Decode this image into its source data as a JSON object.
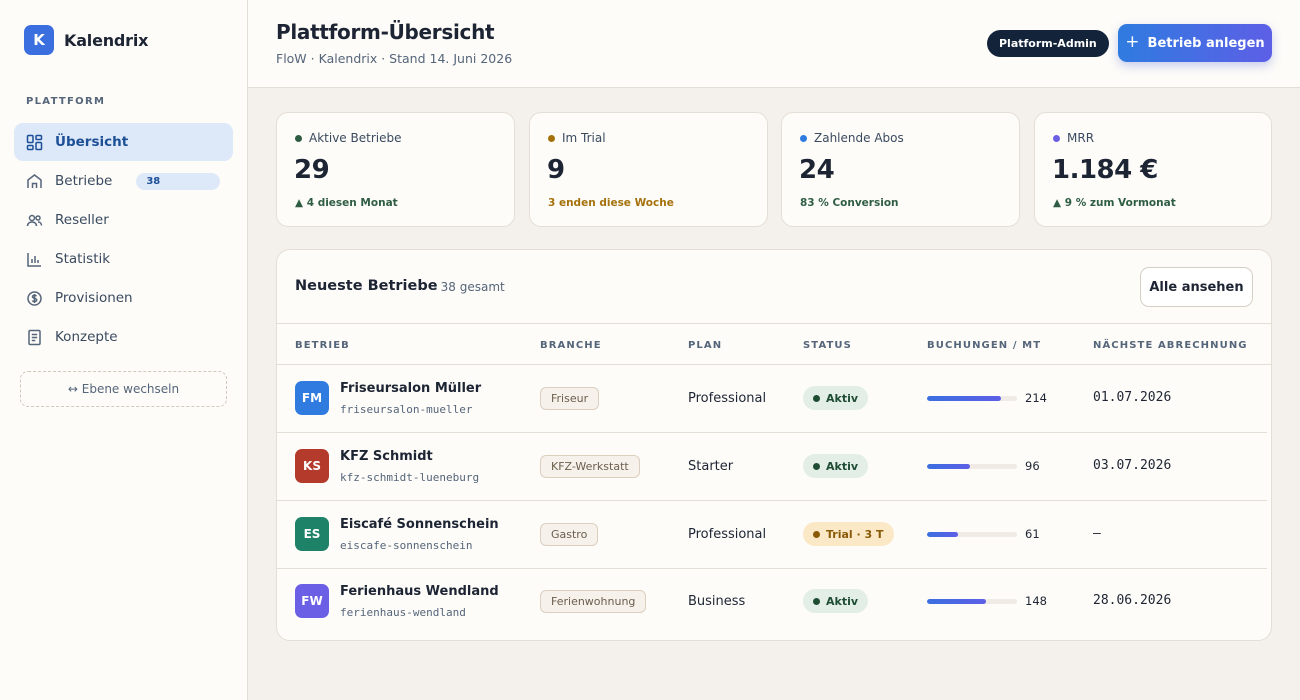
{
  "brand": {
    "logo_letter": "K",
    "name": "Kalendrix"
  },
  "sidebar": {
    "section_label": "PLATTFORM",
    "items": [
      {
        "label": "Übersicht",
        "icon": "grid-icon",
        "active": true
      },
      {
        "label": "Betriebe",
        "icon": "building-icon",
        "badge": "38"
      },
      {
        "label": "Reseller",
        "icon": "users-icon"
      },
      {
        "label": "Statistik",
        "icon": "bar-chart-icon"
      },
      {
        "label": "Provisionen",
        "icon": "coin-icon"
      },
      {
        "label": "Konzepte",
        "icon": "document-icon"
      }
    ],
    "switch_label": "↔ Ebene wechseln"
  },
  "header": {
    "title": "Plattform-Übersicht",
    "subtitle": "FloW · Kalendrix · Stand 14. Juni 2026",
    "role_badge": "Platform-Admin",
    "create_button": "Betrieb anlegen"
  },
  "kpis": [
    {
      "label": "Aktive Betriebe",
      "value": "29",
      "trend": "▲ 4 diesen Monat",
      "dot_color": "#2f5d43",
      "trend_color": "#2f5d43"
    },
    {
      "label": "Im Trial",
      "value": "9",
      "trend": "3 enden diese Woche",
      "dot_color": "#a5710c",
      "trend_color": "#a5710c"
    },
    {
      "label": "Zahlende Abos",
      "value": "24",
      "trend": "83 % Conversion",
      "dot_color": "#2f7be0",
      "trend_color": "#2f5d43"
    },
    {
      "label": "MRR",
      "value": "1.184 €",
      "trend": "▲ 9 % zum Vormonat",
      "dot_color": "#6b5fe6",
      "trend_color": "#2f5d43"
    }
  ],
  "table": {
    "title": "Neueste Betriebe",
    "count": "· 38 gesamt",
    "view_all": "Alle ansehen",
    "columns": [
      "BETRIEB",
      "BRANCHE",
      "PLAN",
      "STATUS",
      "BUCHUNGEN / MT",
      "NÄCHSTE ABRECHNUNG"
    ],
    "rows": [
      {
        "initials": "FM",
        "avatar_color": "#2f7be0",
        "name": "Friseursalon Müller",
        "slug": "friseursalon-mueller",
        "branche": "Friseur",
        "plan": "Professional",
        "status": "Aktiv",
        "status_type": "active",
        "bookings": "214",
        "bookings_fraction": 0.82,
        "billing": "01.07.2026"
      },
      {
        "initials": "KS",
        "avatar_color": "#b43a2c",
        "name": "KFZ Schmidt",
        "slug": "kfz-schmidt-lueneburg",
        "branche": "KFZ-Werkstatt",
        "plan": "Starter",
        "status": "Aktiv",
        "status_type": "active",
        "bookings": "96",
        "bookings_fraction": 0.48,
        "billing": "03.07.2026"
      },
      {
        "initials": "ES",
        "avatar_color": "#1d8268",
        "name": "Eiscafé Sonnenschein",
        "slug": "eiscafe-sonnenschein",
        "branche": "Gastro",
        "plan": "Professional",
        "status": "Trial · 3 T",
        "status_type": "trial",
        "bookings": "61",
        "bookings_fraction": 0.34,
        "billing": "—"
      },
      {
        "initials": "FW",
        "avatar_color": "#6b5fe6",
        "name": "Ferienhaus Wendland",
        "slug": "ferienhaus-wendland",
        "branche": "Ferienwohnung",
        "plan": "Business",
        "status": "Aktiv",
        "status_type": "active",
        "bookings": "148",
        "bookings_fraction": 0.66,
        "billing": "28.06.2026"
      }
    ]
  },
  "colors": {
    "accent": "#2f7be0",
    "status_active_bg": "#e3eee6",
    "status_active_text": "#1f4d34",
    "status_trial_bg": "#fbe8c7",
    "status_trial_text": "#8a5a07"
  }
}
